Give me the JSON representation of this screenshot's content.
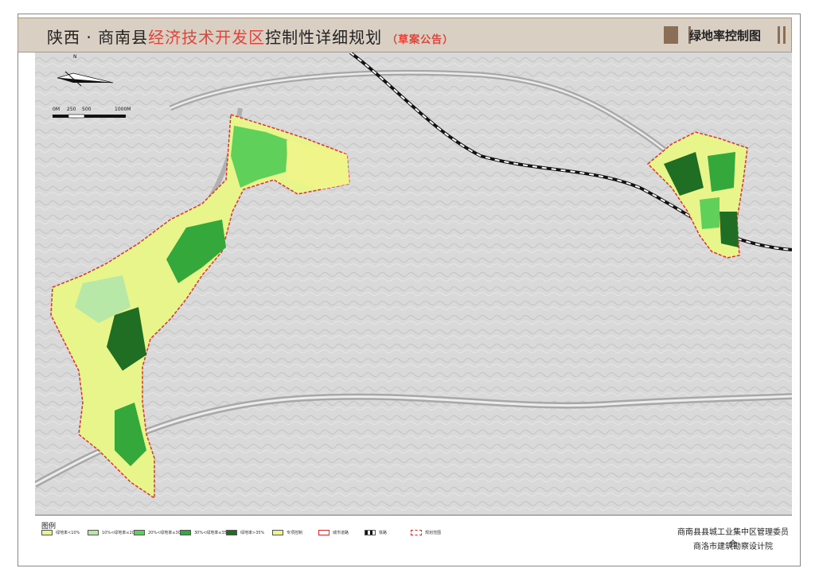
{
  "header": {
    "title_prefix": "陕西 · 商南县",
    "title_highlight": "经济技术开发区",
    "title_suffix": "控制性详细规划",
    "subtitle": "（草案公告）",
    "sheet_name": "绿地率控制图"
  },
  "map": {
    "north_label": "N",
    "scale_labels": [
      "0M",
      "250",
      "500",
      "1000M"
    ],
    "colors": {
      "green_lt10": "#e8f58a",
      "green_10_20": "#b8e8a8",
      "green_20_30": "#5fd05a",
      "green_30_35": "#34a83a",
      "green_gt35": "#1f6e24",
      "special": "#f0f58a",
      "boundary": "#e03030",
      "rail": "#111111"
    }
  },
  "legend": {
    "title": "图例",
    "items": [
      {
        "label": "绿地率<10%",
        "color": "#e8f58a"
      },
      {
        "label": "10%<绿地率≤20%",
        "color": "#b8e8a8"
      },
      {
        "label": "20%<绿地率≤30%",
        "color": "#5fd05a"
      },
      {
        "label": "30%<绿地率≤35%",
        "color": "#34a83a"
      },
      {
        "label": "绿地率>35%",
        "color": "#1f6e24"
      },
      {
        "label": "专项控制",
        "color": "#f0f58a"
      },
      {
        "label": "城市道路",
        "color": "#ffffff"
      },
      {
        "label": "铁路",
        "color": "#111111"
      },
      {
        "label": "规划范围",
        "color": "#e03030"
      }
    ]
  },
  "org": {
    "line1": "商南县县城工业集中区管理委员会",
    "line2": "商洛市建筑勘察设计院"
  }
}
